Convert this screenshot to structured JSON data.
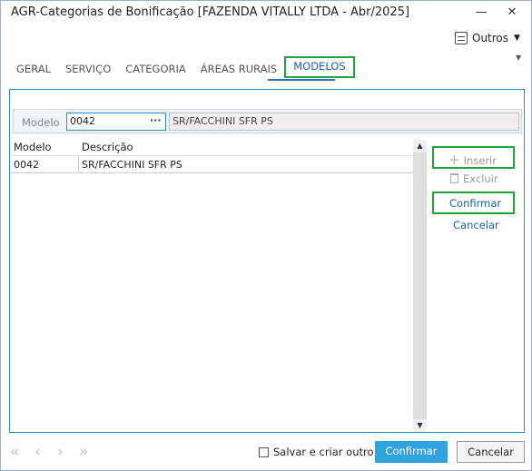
{
  "window": {
    "title": "AGR-Categorias de Bonificação [FAZENDA VITALLY LTDA - Abr/2025]",
    "minimize_glyph": "—",
    "close_glyph": "✕"
  },
  "toolbar": {
    "outros_label": "Outros",
    "outros_icon": "menu-list-icon"
  },
  "tabs": [
    {
      "label": "GERAL"
    },
    {
      "label": "SERVIÇO"
    },
    {
      "label": "CATEGORIA"
    },
    {
      "label": "ÁREAS RURAIS"
    },
    {
      "label": "MODELOS",
      "active": true
    }
  ],
  "modelo": {
    "label": "Modelo",
    "code_value": "0042",
    "lookup_glyph": "···",
    "description_value": "SR/FACCHINI SFR PS"
  },
  "grid": {
    "headers": [
      "Modelo",
      "Descrição"
    ],
    "rows": [
      [
        "0042",
        "SR/FACCHINI SFR PS"
      ]
    ]
  },
  "actions": {
    "inserir": "Inserir",
    "excluir": "Excluir",
    "confirmar": "Confirmar",
    "cancelar": "Cancelar"
  },
  "footer": {
    "save_and_create": "Salvar e criar outro",
    "confirm": "Confirmar",
    "cancel": "Cancelar",
    "nav_first": "«",
    "nav_prev": "‹",
    "nav_next": "›",
    "nav_last": "»"
  },
  "colors": {
    "accent": "#2ea3dd",
    "highlight": "#23a33b",
    "link": "#1a5ea8"
  }
}
